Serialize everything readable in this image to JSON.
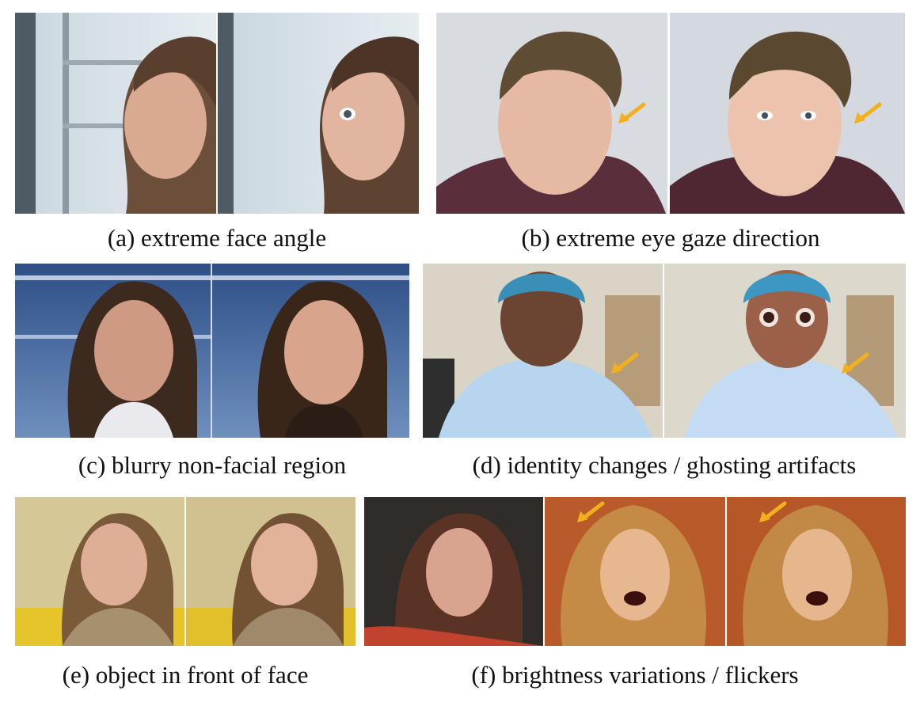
{
  "captions": {
    "a": "(a) extreme face angle",
    "b": "(b) extreme eye gaze direction",
    "c": "(c) blurry non-facial region",
    "d": "(d) identity changes / ghosting artifacts",
    "e": "(e) object in front of face",
    "f": "(f) brightness variations / flickers"
  },
  "colors": {
    "arrow": "#f2b01e"
  }
}
